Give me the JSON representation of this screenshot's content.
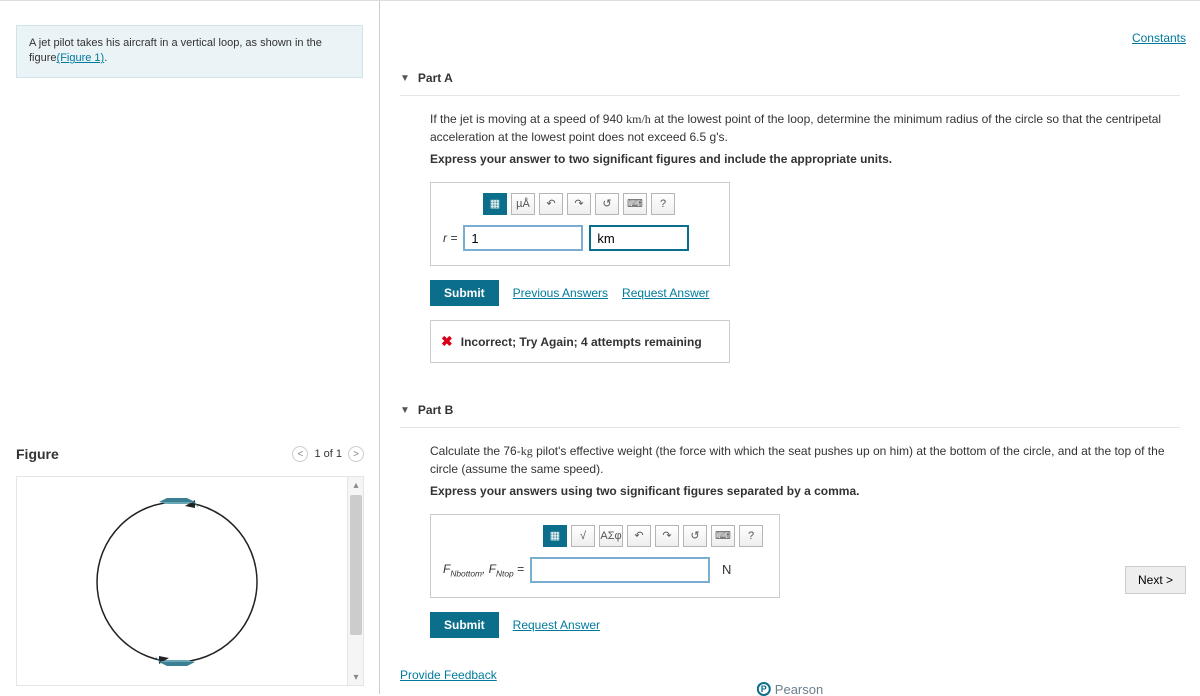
{
  "left": {
    "intro_text_prefix": "A jet pilot takes his aircraft in a vertical loop, as shown in the figure",
    "intro_link": "(Figure 1)",
    "intro_suffix": ".",
    "figure_heading": "Figure",
    "figure_nav": {
      "prev": "<",
      "label": "1 of 1",
      "next": ">"
    }
  },
  "top_links": {
    "constants": "Constants"
  },
  "partA": {
    "header": "Part A",
    "prompt_prefix": "If the jet is moving at a speed of 940 ",
    "prompt_unit": "km/h",
    "prompt_suffix": " at the lowest point of the loop, determine the minimum radius of the circle so that the centripetal acceleration at the lowest point does not exceed 6.5 g's.",
    "instruction": "Express your answer to two significant figures and include the appropriate units.",
    "toolbar": {
      "templates": "▦",
      "units_tool": "µÅ",
      "undo": "↶",
      "redo": "↷",
      "reset": "↺",
      "keyboard": "⌨",
      "help": "?"
    },
    "var_label": "r",
    "equals": " = ",
    "value": "1",
    "unit": "km",
    "submit": "Submit",
    "previous_answers": "Previous Answers",
    "request_answer": "Request Answer",
    "feedback": "Incorrect; Try Again; 4 attempts remaining"
  },
  "partB": {
    "header": "Part B",
    "prompt_prefix": "Calculate the 76-",
    "prompt_unit": "kg",
    "prompt_suffix": " pilot's effective weight (the force with which the seat pushes up on him) at the bottom of the circle, and at the top of the circle (assume the same speed).",
    "instruction": "Express your answers using two significant figures separated by a comma.",
    "toolbar": {
      "templates": "▦",
      "math": "√",
      "symbols": "ΑΣφ",
      "undo": "↶",
      "redo": "↷",
      "reset": "↺",
      "keyboard": "⌨",
      "help": "?"
    },
    "formula_html": "F<sub>Nbottom</sub>, F<sub>Ntop</sub> = ",
    "value": "",
    "unit": "N",
    "submit": "Submit",
    "request_answer": "Request Answer"
  },
  "footer": {
    "provide_feedback": "Provide Feedback",
    "next": "Next >",
    "brand": "Pearson"
  }
}
